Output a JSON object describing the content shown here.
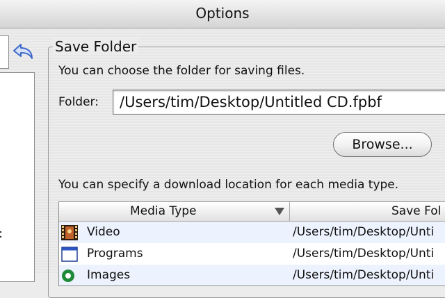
{
  "window": {
    "title": "Options"
  },
  "group": {
    "title": "Save Folder",
    "description": "You can choose the folder for saving files.",
    "folder_label": "Folder:",
    "folder_value": "/Users/tim/Desktop/Untitled CD.fpbf",
    "browse_label": "Browse..."
  },
  "media": {
    "description": "You can specify a download location for each media type.",
    "columns": [
      "Media Type",
      "Save Fol"
    ],
    "rows": [
      {
        "name": "Video",
        "path": "/Users/tim/Desktop/Unti",
        "icon": "video-film-icon"
      },
      {
        "name": "Programs",
        "path": "/Users/tim/Desktop/Unti",
        "icon": "program-window-icon"
      },
      {
        "name": "Images",
        "path": "/Users/tim/Desktop/Unti",
        "icon": "image-icon"
      }
    ]
  },
  "left_panel": {
    "visible_char": ":"
  },
  "colors": {
    "accent": "#3b78d8",
    "row_alt": "#edf3fe"
  }
}
